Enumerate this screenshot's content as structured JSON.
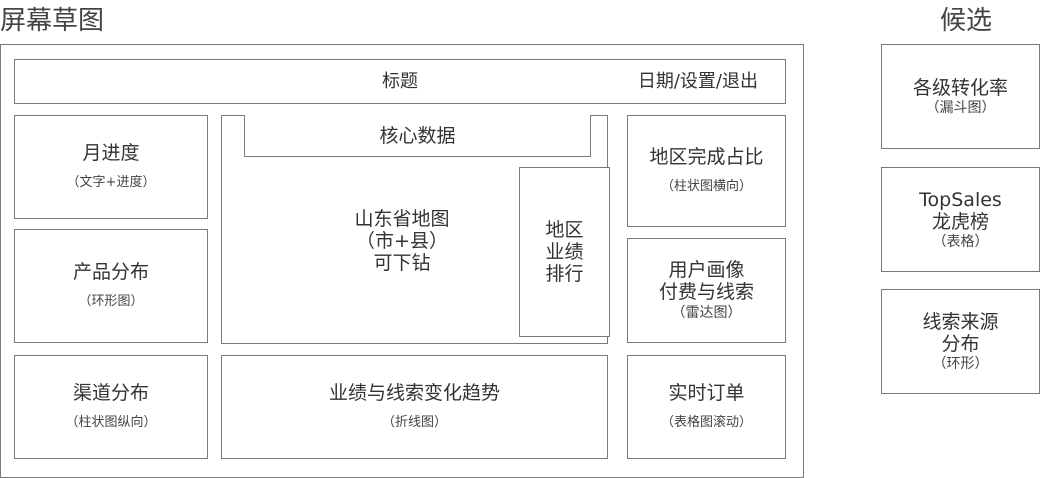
{
  "headings": {
    "sketch": "屏幕草图",
    "candidates": "候选"
  },
  "header": {
    "title": "标题",
    "right": "日期/设置/退出"
  },
  "panels": {
    "month_progress": {
      "title": "月进度",
      "sub": "（文字+进度）"
    },
    "product_dist": {
      "title": "产品分布",
      "sub": "（环形图）"
    },
    "channel_dist": {
      "title": "渠道分布",
      "sub": "（柱状图纵向）"
    },
    "core_data": {
      "title": "核心数据"
    },
    "map": {
      "line1": "山东省地图",
      "line2": "（市+县）",
      "line3": "可下钻"
    },
    "region_rank": {
      "line1": "地区",
      "line2": "业绩",
      "line3": "排行"
    },
    "trend": {
      "title": "业绩与线索变化趋势",
      "sub": "（折线图）"
    },
    "region_completion": {
      "title": "地区完成占比",
      "sub": "（柱状图横向）"
    },
    "user_profile": {
      "line1": "用户画像",
      "line2": "付费与线索",
      "sub": "（雷达图）"
    },
    "realtime_orders": {
      "title": "实时订单",
      "sub": "（表格图滚动）"
    }
  },
  "candidates": {
    "conversion": {
      "title": "各级转化率",
      "sub": "（漏斗图）"
    },
    "topsales": {
      "line1": "TopSales",
      "line2": "龙虎榜",
      "sub": "（表格）"
    },
    "lead_source": {
      "line1": "线索来源",
      "line2": "分布",
      "sub": "（环形）"
    }
  }
}
